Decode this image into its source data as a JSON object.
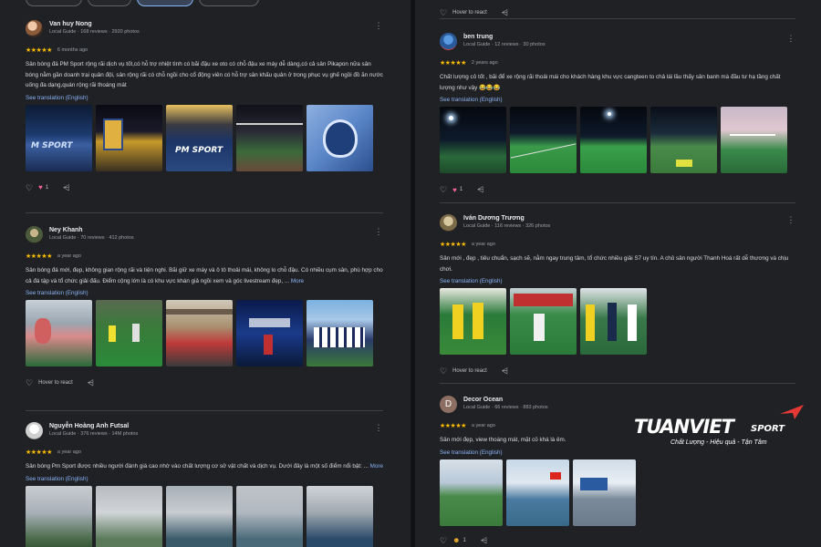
{
  "filters": [
    "",
    "",
    "",
    ""
  ],
  "reviews_left": [
    {
      "name": "Van huy Nong",
      "meta": "Local Guide · 168 reviews · 2920 photos",
      "stars": "★★★★★",
      "time": "6 months ago",
      "text": "Sân bóng đá PM Sport rộng rãi dịch vụ tốt,có hỗ trợ nhiệt tình có bãi đậu xe oto có chỗ đậu xe máy dễ dàng,có cả sân Pikapon nữa sân bóng nằm gần doanh trại quân đội, sân rộng rãi có chỗ ngồi cho cổ động viên có hỗ trợ sân khấu quản ở trong phục vụ ghế ngồi đồ ăn nước uống đa dạng,quán rộng rãi thoáng mát",
      "more": "",
      "translate": "See translation (English)",
      "reaction_label": "",
      "reaction_count": "1",
      "avatar_color": "#c48a6a"
    },
    {
      "name": "Ney Khanh",
      "meta": "Local Guide · 70 reviews · 412 photos",
      "stars": "★★★★★",
      "time": "a year ago",
      "text": "Sân bóng đá mới, đẹp, không gian rộng rãi và tiện nghi. Bãi giữ xe máy và ô tô thoải mái, không lo chỗ đậu. Có nhiều cụm sân, phù hợp cho cả đá tập và tổ chức giải đấu. Điểm cộng lớn là có khu vực khán giả ngồi xem và góc livestream đẹp, ...",
      "more": "More",
      "translate": "See translation (English)",
      "reaction_label": "Hover to react",
      "reaction_count": "",
      "avatar_color": "#6a7b5a"
    },
    {
      "name": "Nguyễn Hoàng Anh Futsal",
      "meta": "Local Guide · 376 reviews · 14M photos",
      "stars": "★★★★★",
      "time": "a year ago",
      "text": "Sân bóng Pm Sport được nhiều người đánh giá cao nhờ vào chất lượng cơ sở vật chất và dịch vụ. Dưới đây là một số điểm nổi bật: ...",
      "more": "More",
      "translate": "See translation (English)",
      "reaction_label": "",
      "reaction_count": "",
      "avatar_color": "#d9d9d9"
    }
  ],
  "reviews_right": [
    {
      "name": "",
      "meta": "",
      "stars": "",
      "time": "",
      "text": "",
      "more": "",
      "translate": "",
      "reaction_label": "Hover to react",
      "reaction_count": "",
      "avatar_color": ""
    },
    {
      "name": "ben trung",
      "meta": "Local Guide · 12 reviews · 30 photos",
      "stars": "★★★★★",
      "time": "2 years ago",
      "text": "Chất lượng cỏ tốt , bãi để xe rộng rãi thoải mái cho khách hàng khu vực cangteen to chả lái lầu thấy sân banh mà đầu tư hạ tầng chất lượng như vậy 😂😂😂",
      "more": "",
      "translate": "See translation (English)",
      "reaction_label": "",
      "reaction_count": "1",
      "avatar_color": "#3b6fb6"
    },
    {
      "name": "Iván Dương Trương",
      "meta": "Local Guide · 116 reviews · 326 photos",
      "stars": "★★★★★",
      "time": "a year ago",
      "text": "Sân mới , đẹp , tiêu chuẩn, sạch sẽ, nằm ngay trung tâm, tổ chức nhiều giải S7 uy tín. A chủ sân người Thanh Hoá rất dễ thương và chịu chơi.",
      "more": "",
      "translate": "See translation (English)",
      "reaction_label": "Hover to react",
      "reaction_count": "",
      "avatar_color": "#8c7a55"
    },
    {
      "name": "Decor Ocean",
      "meta": "Local Guide · 66 reviews · 883 photos",
      "stars": "★★★★★",
      "time": "a year ago",
      "text": "Sân mới đẹp, view thoáng mát, mặt cỏ khá là êm.",
      "more": "",
      "translate": "See translation (English)",
      "reaction_label": "",
      "reaction_count": "1",
      "avatar_color": "#8d6e63"
    }
  ],
  "logo": {
    "brand": "TUANVIET",
    "sport": "SPORT",
    "tagline": "Chất Lượng - Hiệu quả - Tận Tâm",
    "accent": "#e53935"
  }
}
